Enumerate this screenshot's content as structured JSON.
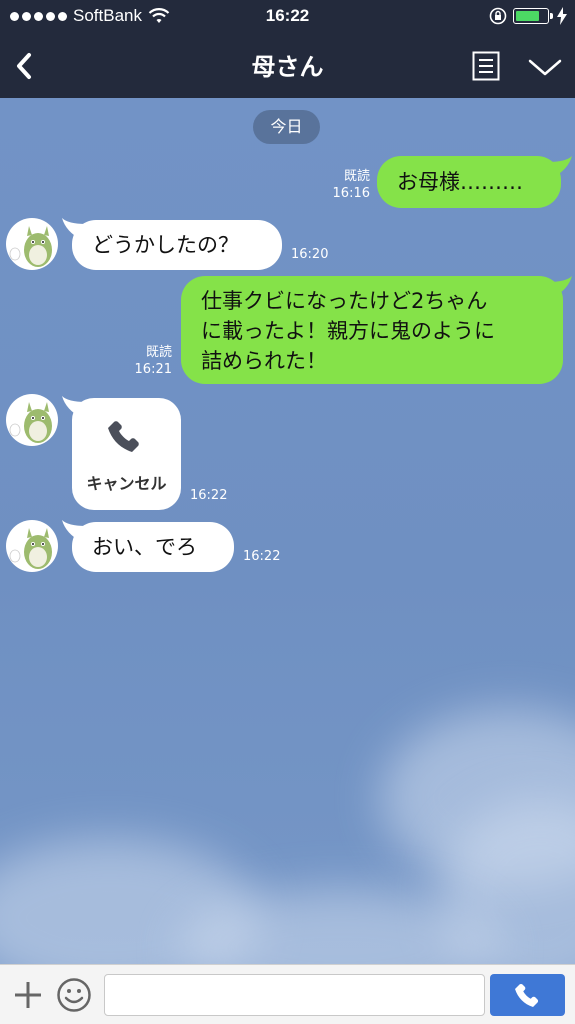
{
  "status_bar": {
    "carrier": "SoftBank",
    "time": "16:22",
    "battery_level": 0.8,
    "signal_bars": 5
  },
  "nav": {
    "title": "母さん"
  },
  "chat": {
    "date_label": "今日",
    "messages": [
      {
        "direction": "out",
        "text": "お母様………",
        "read_label": "既読",
        "time": "16:16"
      },
      {
        "direction": "in",
        "text": "どうかしたの？",
        "time": "16:20"
      },
      {
        "direction": "out",
        "lines": [
          "仕事クビになったけど2ちゃん",
          "に載ったよ！親方に鬼のように",
          "詰められた！"
        ],
        "read_label": "既読",
        "time": "16:21"
      },
      {
        "direction": "in",
        "type": "call",
        "label": "キャンセル",
        "time": "16:22"
      },
      {
        "direction": "in",
        "text": "おい、でろ",
        "time": "16:22"
      }
    ]
  },
  "input_bar": {
    "value": "",
    "placeholder": ""
  },
  "colors": {
    "bar_background": "#232a3c",
    "outgoing_bubble": "#85e249",
    "incoming_bubble": "#ffffff",
    "chat_background": "#7091c4",
    "call_button": "#3f78d6",
    "battery_fill": "#4cd964"
  },
  "icons": {
    "back": "chevron-left-icon",
    "menu": "document-list-icon",
    "collapse": "chevron-down-icon",
    "wifi": "wifi-icon",
    "rotation_lock": "rotation-lock-icon",
    "charging": "bolt-icon",
    "plus": "plus-icon",
    "emoji": "smiley-icon",
    "call": "phone-icon"
  }
}
